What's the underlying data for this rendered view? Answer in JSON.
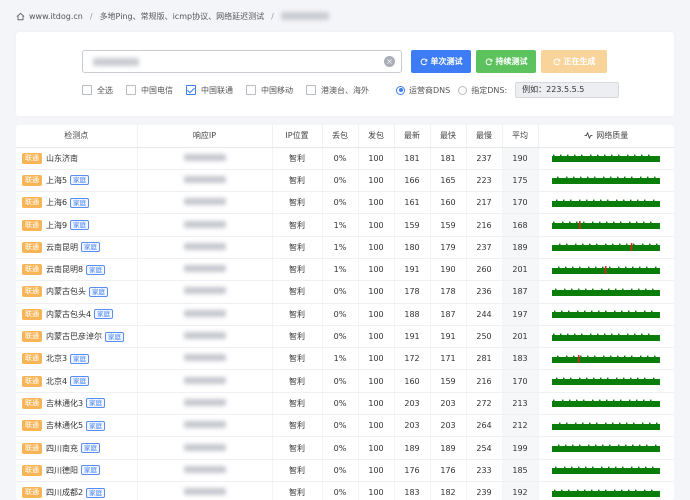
{
  "breadcrumb": {
    "site": "www.itdog.cn",
    "section": "多地Ping、常规版、icmp协议、网络延迟测试"
  },
  "search": {
    "clear_symbol": "×"
  },
  "buttons": {
    "single": "单次测试",
    "continuous": "持续测试",
    "generating": "正在生成"
  },
  "filters": [
    {
      "label": "全选",
      "checked": false
    },
    {
      "label": "中国电信",
      "checked": false
    },
    {
      "label": "中国联通",
      "checked": true
    },
    {
      "label": "中国移动",
      "checked": false
    },
    {
      "label": "港澳台、海外",
      "checked": false
    }
  ],
  "dns": {
    "option_isp": "运营商DNS",
    "option_custom": "指定DNS:",
    "selected": "isp",
    "input_value": "例如：223.5.5.5"
  },
  "table": {
    "headers": {
      "location": "检测点",
      "ip": "响应IP",
      "ip_location": "IP位置",
      "loss": "丢包",
      "sent": "发包",
      "latest": "最新",
      "fastest": "最快",
      "slowest": "最慢",
      "avg": "平均",
      "quality": "网络质量"
    },
    "isp_label": "联通",
    "home_tag": "家庭",
    "quality_color": "#0a7d0a",
    "spike_color": "#e02020",
    "rows": [
      {
        "location": "山东济南",
        "home": false,
        "ip_loc": "智利",
        "loss": "0%",
        "sent": "100",
        "latest": "181",
        "fastest": "181",
        "slowest": "237",
        "avg": "190",
        "spikes": []
      },
      {
        "location": "上海5",
        "home": true,
        "ip_loc": "智利",
        "loss": "0%",
        "sent": "100",
        "latest": "166",
        "fastest": "165",
        "slowest": "223",
        "avg": "175",
        "spikes": []
      },
      {
        "location": "上海6",
        "home": true,
        "ip_loc": "智利",
        "loss": "0%",
        "sent": "100",
        "latest": "161",
        "fastest": "160",
        "slowest": "217",
        "avg": "170",
        "spikes": []
      },
      {
        "location": "上海9",
        "home": true,
        "ip_loc": "智利",
        "loss": "1%",
        "sent": "100",
        "latest": "159",
        "fastest": "159",
        "slowest": "216",
        "avg": "168",
        "spikes": [
          0.25
        ]
      },
      {
        "location": "云南昆明",
        "home": true,
        "ip_loc": "智利",
        "loss": "1%",
        "sent": "100",
        "latest": "180",
        "fastest": "179",
        "slowest": "237",
        "avg": "189",
        "spikes": [
          0.73
        ]
      },
      {
        "location": "云南昆明8",
        "home": true,
        "ip_loc": "智利",
        "loss": "1%",
        "sent": "100",
        "latest": "191",
        "fastest": "190",
        "slowest": "260",
        "avg": "201",
        "spikes": [
          0.49
        ]
      },
      {
        "location": "内蒙古包头",
        "home": true,
        "ip_loc": "智利",
        "loss": "0%",
        "sent": "100",
        "latest": "178",
        "fastest": "178",
        "slowest": "236",
        "avg": "187",
        "spikes": []
      },
      {
        "location": "内蒙古包头4",
        "home": true,
        "ip_loc": "智利",
        "loss": "0%",
        "sent": "100",
        "latest": "188",
        "fastest": "187",
        "slowest": "244",
        "avg": "197",
        "spikes": []
      },
      {
        "location": "内蒙古巴彦淖尔",
        "home": true,
        "ip_loc": "智利",
        "loss": "0%",
        "sent": "100",
        "latest": "191",
        "fastest": "191",
        "slowest": "250",
        "avg": "201",
        "spikes": []
      },
      {
        "location": "北京3",
        "home": true,
        "ip_loc": "智利",
        "loss": "1%",
        "sent": "100",
        "latest": "172",
        "fastest": "171",
        "slowest": "281",
        "avg": "183",
        "spikes": [
          0.24
        ]
      },
      {
        "location": "北京4",
        "home": true,
        "ip_loc": "智利",
        "loss": "0%",
        "sent": "100",
        "latest": "160",
        "fastest": "159",
        "slowest": "216",
        "avg": "170",
        "spikes": []
      },
      {
        "location": "吉林通化3",
        "home": true,
        "ip_loc": "智利",
        "loss": "0%",
        "sent": "100",
        "latest": "203",
        "fastest": "203",
        "slowest": "272",
        "avg": "213",
        "spikes": []
      },
      {
        "location": "吉林通化5",
        "home": true,
        "ip_loc": "智利",
        "loss": "0%",
        "sent": "100",
        "latest": "203",
        "fastest": "203",
        "slowest": "264",
        "avg": "212",
        "spikes": []
      },
      {
        "location": "四川南充",
        "home": true,
        "ip_loc": "智利",
        "loss": "0%",
        "sent": "100",
        "latest": "189",
        "fastest": "189",
        "slowest": "254",
        "avg": "199",
        "spikes": []
      },
      {
        "location": "四川德阳",
        "home": true,
        "ip_loc": "智利",
        "loss": "0%",
        "sent": "100",
        "latest": "176",
        "fastest": "176",
        "slowest": "233",
        "avg": "185",
        "spikes": []
      },
      {
        "location": "四川成都2",
        "home": true,
        "ip_loc": "智利",
        "loss": "0%",
        "sent": "100",
        "latest": "183",
        "fastest": "182",
        "slowest": "239",
        "avg": "192",
        "spikes": []
      }
    ]
  }
}
